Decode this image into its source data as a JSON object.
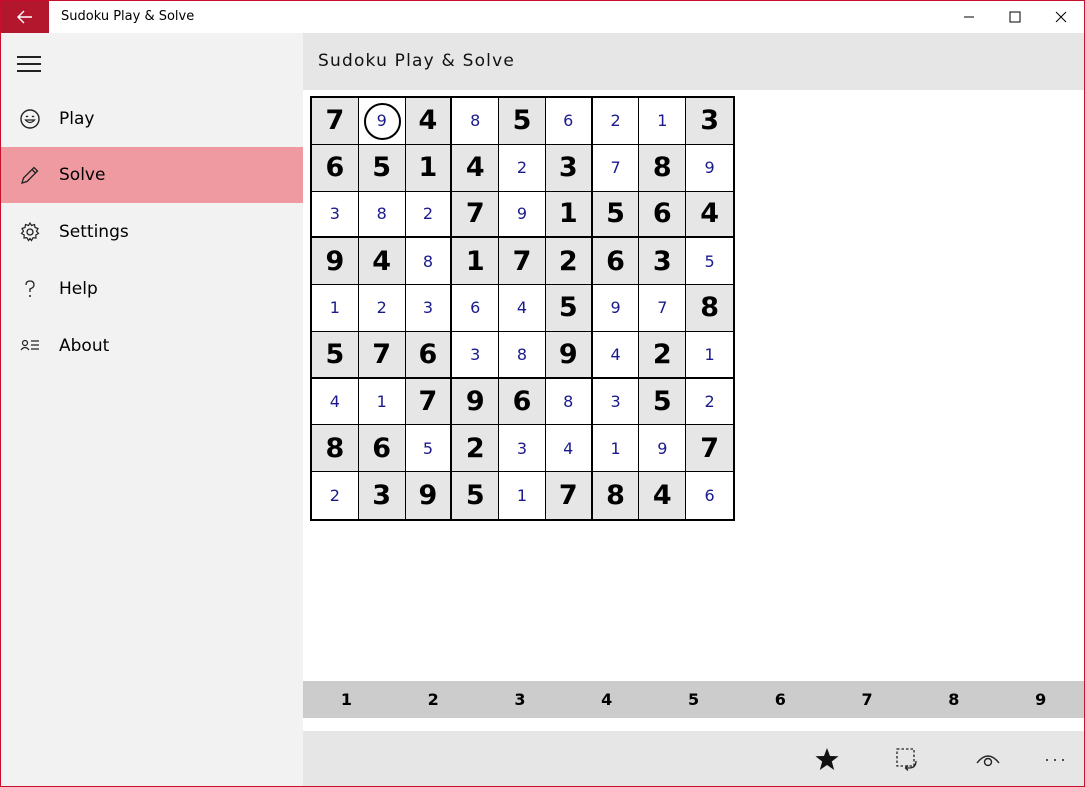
{
  "window": {
    "title": "Sudoku Play & Solve",
    "accent": "#b2172e"
  },
  "sidebar": {
    "items": [
      {
        "label": "Play",
        "icon": "smiley-icon",
        "active": false
      },
      {
        "label": "Solve",
        "icon": "pencil-icon",
        "active": true
      },
      {
        "label": "Settings",
        "icon": "gear-icon",
        "active": false
      },
      {
        "label": "Help",
        "icon": "question-icon",
        "active": false
      },
      {
        "label": "About",
        "icon": "about-icon",
        "active": false
      }
    ],
    "active_color": "#ef9aa1"
  },
  "main": {
    "title": "Sudoku Play & Solve"
  },
  "board": {
    "selected": [
      0,
      1
    ],
    "rows": [
      [
        {
          "v": "7",
          "g": true
        },
        {
          "v": "9",
          "g": false
        },
        {
          "v": "4",
          "g": true
        },
        {
          "v": "8",
          "g": false
        },
        {
          "v": "5",
          "g": true
        },
        {
          "v": "6",
          "g": false
        },
        {
          "v": "2",
          "g": false
        },
        {
          "v": "1",
          "g": false
        },
        {
          "v": "3",
          "g": true
        }
      ],
      [
        {
          "v": "6",
          "g": true
        },
        {
          "v": "5",
          "g": true
        },
        {
          "v": "1",
          "g": true
        },
        {
          "v": "4",
          "g": true
        },
        {
          "v": "2",
          "g": false
        },
        {
          "v": "3",
          "g": true
        },
        {
          "v": "7",
          "g": false
        },
        {
          "v": "8",
          "g": true
        },
        {
          "v": "9",
          "g": false
        }
      ],
      [
        {
          "v": "3",
          "g": false
        },
        {
          "v": "8",
          "g": false
        },
        {
          "v": "2",
          "g": false
        },
        {
          "v": "7",
          "g": true
        },
        {
          "v": "9",
          "g": false
        },
        {
          "v": "1",
          "g": true
        },
        {
          "v": "5",
          "g": true
        },
        {
          "v": "6",
          "g": true
        },
        {
          "v": "4",
          "g": true
        }
      ],
      [
        {
          "v": "9",
          "g": true
        },
        {
          "v": "4",
          "g": true
        },
        {
          "v": "8",
          "g": false
        },
        {
          "v": "1",
          "g": true
        },
        {
          "v": "7",
          "g": true
        },
        {
          "v": "2",
          "g": true
        },
        {
          "v": "6",
          "g": true
        },
        {
          "v": "3",
          "g": true
        },
        {
          "v": "5",
          "g": false
        }
      ],
      [
        {
          "v": "1",
          "g": false
        },
        {
          "v": "2",
          "g": false
        },
        {
          "v": "3",
          "g": false
        },
        {
          "v": "6",
          "g": false
        },
        {
          "v": "4",
          "g": false
        },
        {
          "v": "5",
          "g": true
        },
        {
          "v": "9",
          "g": false
        },
        {
          "v": "7",
          "g": false
        },
        {
          "v": "8",
          "g": true
        }
      ],
      [
        {
          "v": "5",
          "g": true
        },
        {
          "v": "7",
          "g": true
        },
        {
          "v": "6",
          "g": true
        },
        {
          "v": "3",
          "g": false
        },
        {
          "v": "8",
          "g": false
        },
        {
          "v": "9",
          "g": true
        },
        {
          "v": "4",
          "g": false
        },
        {
          "v": "2",
          "g": true
        },
        {
          "v": "1",
          "g": false
        }
      ],
      [
        {
          "v": "4",
          "g": false
        },
        {
          "v": "1",
          "g": false
        },
        {
          "v": "7",
          "g": true
        },
        {
          "v": "9",
          "g": true
        },
        {
          "v": "6",
          "g": true
        },
        {
          "v": "8",
          "g": false
        },
        {
          "v": "3",
          "g": false
        },
        {
          "v": "5",
          "g": true
        },
        {
          "v": "2",
          "g": false
        }
      ],
      [
        {
          "v": "8",
          "g": true
        },
        {
          "v": "6",
          "g": true
        },
        {
          "v": "5",
          "g": false
        },
        {
          "v": "2",
          "g": true
        },
        {
          "v": "3",
          "g": false
        },
        {
          "v": "4",
          "g": false
        },
        {
          "v": "1",
          "g": false
        },
        {
          "v": "9",
          "g": false
        },
        {
          "v": "7",
          "g": true
        }
      ],
      [
        {
          "v": "2",
          "g": false
        },
        {
          "v": "3",
          "g": true
        },
        {
          "v": "9",
          "g": true
        },
        {
          "v": "5",
          "g": true
        },
        {
          "v": "1",
          "g": false
        },
        {
          "v": "7",
          "g": true
        },
        {
          "v": "8",
          "g": true
        },
        {
          "v": "4",
          "g": true
        },
        {
          "v": "6",
          "g": false
        }
      ]
    ]
  },
  "number_bar": [
    "1",
    "2",
    "3",
    "4",
    "5",
    "6",
    "7",
    "8",
    "9"
  ],
  "commands": [
    {
      "icon": "star-icon"
    },
    {
      "icon": "select-undo-icon"
    },
    {
      "icon": "eye-icon"
    },
    {
      "icon": "more-icon",
      "label": "···"
    }
  ]
}
